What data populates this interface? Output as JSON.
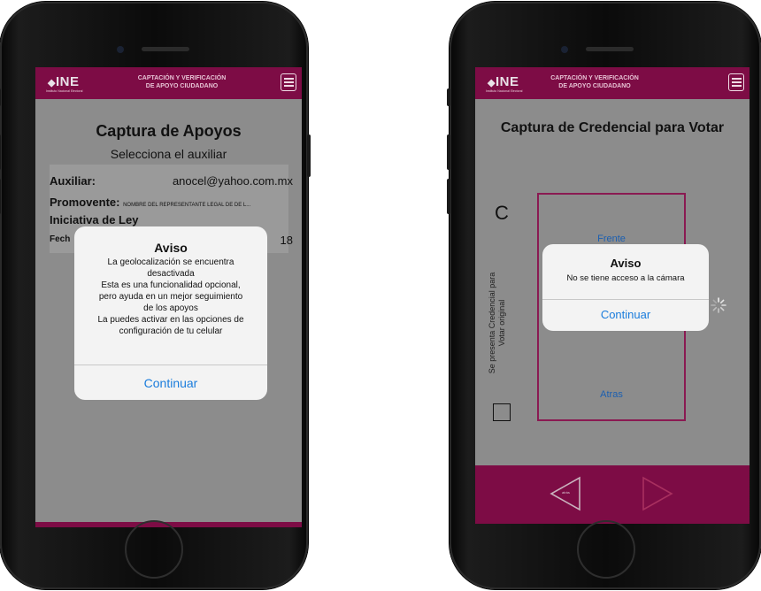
{
  "app": {
    "logo": "INE",
    "logo_sub": "Instituto Nacional Electoral",
    "title_line1": "CAPTACIÓN Y VERIFICACIÓN",
    "title_line2": "DE APOYO CIUDADANO",
    "bar_color": "#7d0c45"
  },
  "left": {
    "heading": "Captura de Apoyos",
    "subheading": "Selecciona el auxiliar",
    "auxiliar_label": "Auxiliar:",
    "auxiliar_value": "anocel@yahoo.com.mx",
    "promovente_label": "Promovente:",
    "promovente_value": "NOMBRE DEL REPRESENTANTE LEGAL DE DE L...",
    "iniciativa": "Iniciativa de Ley",
    "fecha_label": "Fech",
    "fecha_suffix": "18",
    "alert": {
      "title": "Aviso",
      "line1": "La geolocalización se encuentra",
      "line2": "desactivada",
      "line3": "Esta es una funcionalidad opcional,",
      "line4": "pero ayuda en un mejor seguimiento",
      "line5": "de los apoyos",
      "line6": "La puedes activar en las opciones de",
      "line7": "configuración de tu celular",
      "button": "Continuar"
    }
  },
  "right": {
    "heading": "Captura de Credencial para Votar",
    "c_letter": "C",
    "side_text_1": "Se presenta Credencial para",
    "side_text_2": "Votar original",
    "frente": "Frente",
    "atras": "Atras",
    "alert": {
      "title": "Aviso",
      "body": "No se tiene acceso a la cámara",
      "button": "Continuar"
    },
    "back_label": "atrás"
  }
}
